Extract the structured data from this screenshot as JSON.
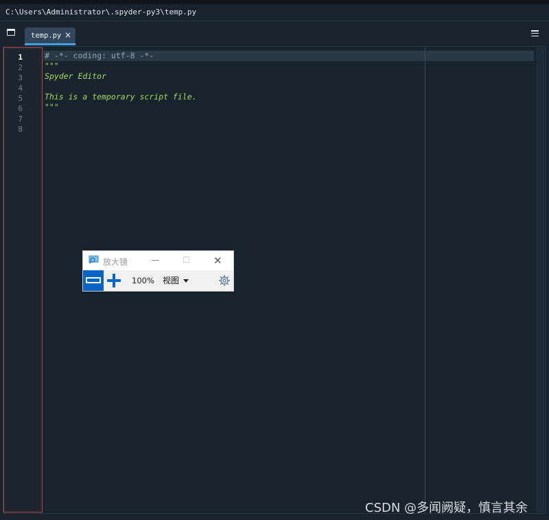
{
  "window": {
    "file_path": "C:\\Users\\Administrator\\.spyder-py3\\temp.py"
  },
  "editor": {
    "tabs": [
      {
        "label": "temp.py",
        "close_glyph": "×",
        "active": true
      }
    ],
    "line_numbers": [
      "1",
      "2",
      "3",
      "4",
      "5",
      "6",
      "7",
      "8"
    ],
    "current_line": 1,
    "code_lines": [
      {
        "text": "# -*- coding: utf-8 -*-",
        "kind": "comment"
      },
      {
        "text": "\"\"\"",
        "kind": "string"
      },
      {
        "text": "Spyder Editor",
        "kind": "string"
      },
      {
        "text": "",
        "kind": "string"
      },
      {
        "text": "This is a temporary script file.",
        "kind": "string"
      },
      {
        "text": "\"\"\"",
        "kind": "string"
      },
      {
        "text": "",
        "kind": "plain"
      },
      {
        "text": "",
        "kind": "plain"
      }
    ],
    "colors": {
      "background": "#19232d",
      "comment": "#9aa5b1",
      "string": "#a5d95e",
      "tab_accent": "#37a3ff",
      "gutter_highlight": "#c9433a"
    },
    "icons": {
      "browse_tabs": "browse-tabs-icon",
      "options": "hamburger-menu-icon"
    }
  },
  "magnifier": {
    "title": "放大镜",
    "zoom_level": "100%",
    "view_menu": "视图",
    "close_glyph": "✕",
    "accent": "#0a64c8",
    "icons": {
      "app": "magnifier-app-icon",
      "zoom_out": "minus-icon",
      "zoom_in": "plus-icon",
      "settings": "gear-icon"
    }
  },
  "watermark": "CSDN @多闻阙疑，慎言其余"
}
